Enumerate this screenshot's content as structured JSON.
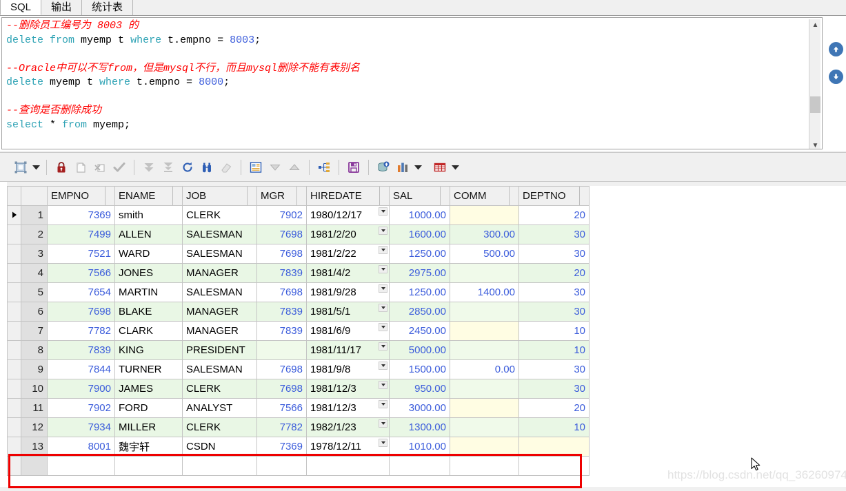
{
  "tabs": [
    {
      "label": "SQL",
      "active": true
    },
    {
      "label": "输出",
      "active": false
    },
    {
      "label": "统计表",
      "active": false
    }
  ],
  "editor": {
    "lines": [
      {
        "type": "comment",
        "text": "--删除员工编号为 8003 的"
      },
      {
        "type": "sql",
        "tokens": [
          {
            "t": "delete",
            "c": "kw"
          },
          {
            "t": " ",
            "c": "plain"
          },
          {
            "t": "from",
            "c": "kw"
          },
          {
            "t": " myemp t ",
            "c": "plain"
          },
          {
            "t": "where",
            "c": "kw"
          },
          {
            "t": " t.empno = ",
            "c": "plain"
          },
          {
            "t": "8003",
            "c": "num"
          },
          {
            "t": ";",
            "c": "plain"
          }
        ]
      },
      {
        "type": "blank",
        "text": ""
      },
      {
        "type": "comment",
        "text": "--Oracle中可以不写from，但是mysql不行，而且mysql删除不能有表别名"
      },
      {
        "type": "sql",
        "tokens": [
          {
            "t": "delete",
            "c": "kw"
          },
          {
            "t": " myemp t ",
            "c": "plain"
          },
          {
            "t": "where",
            "c": "kw"
          },
          {
            "t": " t.empno = ",
            "c": "plain"
          },
          {
            "t": "8000",
            "c": "num"
          },
          {
            "t": ";",
            "c": "plain"
          }
        ]
      },
      {
        "type": "blank",
        "text": ""
      },
      {
        "type": "comment",
        "text": "--查询是否删除成功"
      },
      {
        "type": "sql",
        "tokens": [
          {
            "t": "select",
            "c": "kw"
          },
          {
            "t": " * ",
            "c": "plain"
          },
          {
            "t": "from",
            "c": "kw"
          },
          {
            "t": " myemp;",
            "c": "plain"
          }
        ]
      }
    ]
  },
  "toolbar": {
    "items": [
      {
        "name": "grid-mode-button",
        "icon": "grid-select-icon"
      },
      {
        "name": "grid-mode-dropdown",
        "icon": "caret-down-icon"
      },
      {
        "name": "separator-1",
        "icon": "separator"
      },
      {
        "name": "lock-record-button",
        "icon": "lock-icon"
      },
      {
        "name": "insert-record-button",
        "icon": "new-record-icon"
      },
      {
        "name": "delete-record-button",
        "icon": "delete-record-icon"
      },
      {
        "name": "commit-button",
        "icon": "check-icon"
      },
      {
        "name": "separator-2",
        "icon": "separator"
      },
      {
        "name": "fetch-next-page-button",
        "icon": "double-down-icon"
      },
      {
        "name": "fetch-last-page-button",
        "icon": "down-to-bar-icon"
      },
      {
        "name": "refresh-button",
        "icon": "refresh-icon"
      },
      {
        "name": "find-button",
        "icon": "binoculars-icon"
      },
      {
        "name": "clear-filter-button",
        "icon": "eraser-icon"
      },
      {
        "name": "separator-3",
        "icon": "separator"
      },
      {
        "name": "single-record-view-button",
        "icon": "record-form-icon"
      },
      {
        "name": "move-down-button",
        "icon": "triangle-down-icon"
      },
      {
        "name": "move-up-button",
        "icon": "triangle-up-icon"
      },
      {
        "name": "separator-4",
        "icon": "separator"
      },
      {
        "name": "explain-plan-button",
        "icon": "hierarchy-icon"
      },
      {
        "name": "separator-5",
        "icon": "separator"
      },
      {
        "name": "save-button",
        "icon": "floppy-save-icon"
      },
      {
        "name": "separator-6",
        "icon": "separator"
      },
      {
        "name": "export-db-button",
        "icon": "database-upload-icon"
      },
      {
        "name": "chart-button",
        "icon": "bar-chart-icon"
      },
      {
        "name": "chart-dropdown",
        "icon": "caret-down-icon"
      },
      {
        "name": "table-export-button",
        "icon": "red-table-icon"
      },
      {
        "name": "table-export-dropdown",
        "icon": "caret-down-icon"
      }
    ]
  },
  "grid": {
    "columns": [
      "EMPNO",
      "ENAME",
      "JOB",
      "MGR",
      "HIREDATE",
      "SAL",
      "COMM",
      "DEPTNO"
    ],
    "rows": [
      {
        "n": "1",
        "EMPNO": "7369",
        "ENAME": "smith",
        "JOB": "CLERK",
        "MGR": "7902",
        "HIREDATE": "1980/12/17",
        "SAL": "1000.00",
        "COMM": "",
        "DEPTNO": "20",
        "current": true
      },
      {
        "n": "2",
        "EMPNO": "7499",
        "ENAME": "ALLEN",
        "JOB": "SALESMAN",
        "MGR": "7698",
        "HIREDATE": "1981/2/20",
        "SAL": "1600.00",
        "COMM": "300.00",
        "DEPTNO": "30"
      },
      {
        "n": "3",
        "EMPNO": "7521",
        "ENAME": "WARD",
        "JOB": "SALESMAN",
        "MGR": "7698",
        "HIREDATE": "1981/2/22",
        "SAL": "1250.00",
        "COMM": "500.00",
        "DEPTNO": "30"
      },
      {
        "n": "4",
        "EMPNO": "7566",
        "ENAME": "JONES",
        "JOB": "MANAGER",
        "MGR": "7839",
        "HIREDATE": "1981/4/2",
        "SAL": "2975.00",
        "COMM": "",
        "DEPTNO": "20"
      },
      {
        "n": "5",
        "EMPNO": "7654",
        "ENAME": "MARTIN",
        "JOB": "SALESMAN",
        "MGR": "7698",
        "HIREDATE": "1981/9/28",
        "SAL": "1250.00",
        "COMM": "1400.00",
        "DEPTNO": "30"
      },
      {
        "n": "6",
        "EMPNO": "7698",
        "ENAME": "BLAKE",
        "JOB": "MANAGER",
        "MGR": "7839",
        "HIREDATE": "1981/5/1",
        "SAL": "2850.00",
        "COMM": "",
        "DEPTNO": "30"
      },
      {
        "n": "7",
        "EMPNO": "7782",
        "ENAME": "CLARK",
        "JOB": "MANAGER",
        "MGR": "7839",
        "HIREDATE": "1981/6/9",
        "SAL": "2450.00",
        "COMM": "",
        "DEPTNO": "10"
      },
      {
        "n": "8",
        "EMPNO": "7839",
        "ENAME": "KING",
        "JOB": "PRESIDENT",
        "MGR": "",
        "HIREDATE": "1981/11/17",
        "SAL": "5000.00",
        "COMM": "",
        "DEPTNO": "10"
      },
      {
        "n": "9",
        "EMPNO": "7844",
        "ENAME": "TURNER",
        "JOB": "SALESMAN",
        "MGR": "7698",
        "HIREDATE": "1981/9/8",
        "SAL": "1500.00",
        "COMM": "0.00",
        "DEPTNO": "30"
      },
      {
        "n": "10",
        "EMPNO": "7900",
        "ENAME": "JAMES",
        "JOB": "CLERK",
        "MGR": "7698",
        "HIREDATE": "1981/12/3",
        "SAL": "950.00",
        "COMM": "",
        "DEPTNO": "30"
      },
      {
        "n": "11",
        "EMPNO": "7902",
        "ENAME": "FORD",
        "JOB": "ANALYST",
        "MGR": "7566",
        "HIREDATE": "1981/12/3",
        "SAL": "3000.00",
        "COMM": "",
        "DEPTNO": "20"
      },
      {
        "n": "12",
        "EMPNO": "7934",
        "ENAME": "MILLER",
        "JOB": "CLERK",
        "MGR": "7782",
        "HIREDATE": "1982/1/23",
        "SAL": "1300.00",
        "COMM": "",
        "DEPTNO": "10"
      },
      {
        "n": "13",
        "EMPNO": "8001",
        "ENAME": "魏宇轩",
        "JOB": "CSDN",
        "MGR": "7369",
        "HIREDATE": "1978/12/11",
        "SAL": "1010.00",
        "COMM": "",
        "DEPTNO": "",
        "highlighted": true
      }
    ]
  },
  "watermark": "https://blog.csdn.net/qq_36260974",
  "colors": {
    "comment": "#ff0000",
    "keyword": "#2fa3b5",
    "number": "#3b5cdb",
    "alt_row": "#e9f7e5",
    "null_cell": "#fffde3",
    "highlight_box": "#ee0000",
    "nav_button": "#3f76b5"
  }
}
